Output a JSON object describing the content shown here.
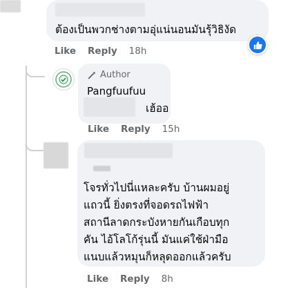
{
  "comments": [
    {
      "text": "ต้องเป็นพวกช่างตามอุ่แน่นอนมันรุ้วิธิงัด",
      "actions": {
        "like": "Like",
        "reply": "Reply",
        "time": "18h"
      },
      "reaction": "like-icon"
    },
    {
      "author_badge": "Author",
      "name": "Pangfuufuu",
      "text": "เฮ้ออ",
      "actions": {
        "like": "Like",
        "reply": "Reply",
        "time": "15h"
      }
    },
    {
      "text": "โจรทั่วไปนี่แหละครับ บ้านผมอยู่\nแถวนี้ ยิ่งตรงที่จอดรถไฟฟ้า\nสถานีลาดกระบังหายกันเกือบทุก\nคัน ไอ้โลโก้รุ่นนี้ มันแค่ใช้ฝ่ามือ\nแนบแล้วหมุนก็หลุดออกแล้วครับ",
      "actions": {
        "like": "Like",
        "reply": "Reply",
        "time": "8h"
      }
    }
  ],
  "colors": {
    "bubble": "#f0f2f5",
    "meta": "#65676b",
    "like_blue": "#1877f2",
    "thread_line": "#ced0d4"
  }
}
